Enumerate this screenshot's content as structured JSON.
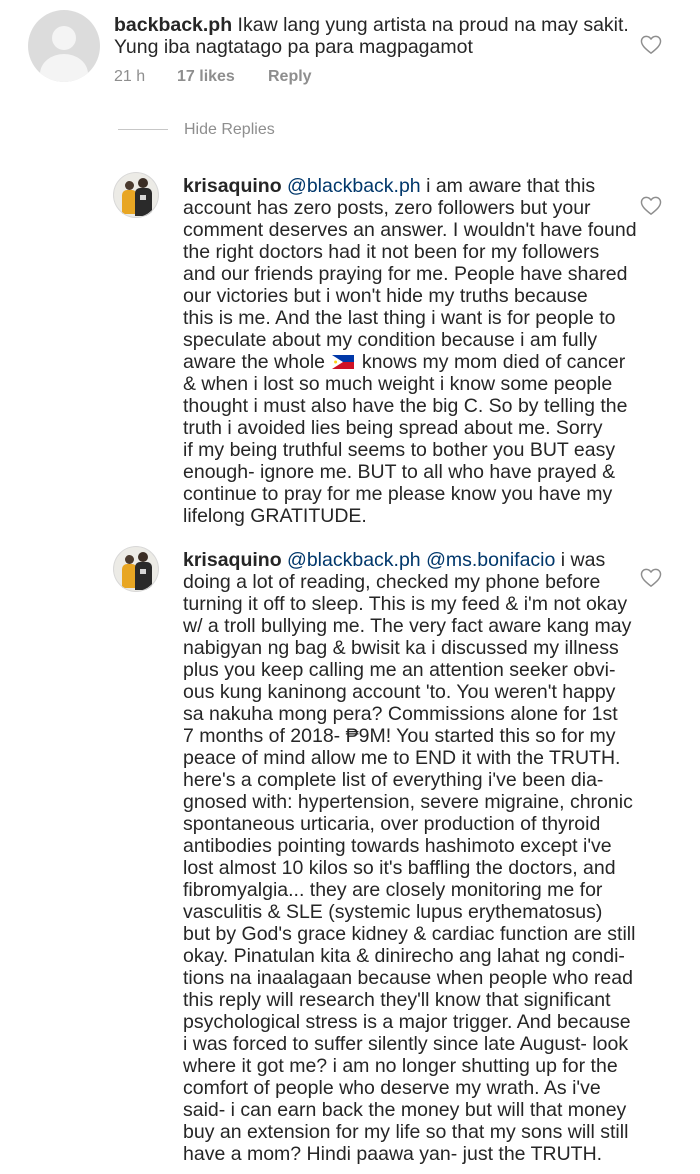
{
  "top_comment": {
    "username": "backback.ph",
    "lines": [
      " Ikaw lang yung artista na proud na may sakit.",
      "Yung iba nagtatago pa para magpagamot"
    ],
    "time": "21 h",
    "likes": "17 likes",
    "reply_label": "Reply"
  },
  "hide_replies_label": "Hide Replies",
  "reply1": {
    "username": "krisaquino",
    "mention": "@blackback.ph",
    "first_line_rest": " i am aware that this",
    "lines": [
      "account has zero posts, zero followers but your",
      "comment deserves an answer. I wouldn't have found",
      "the right doctors had it not been for my followers",
      "and our friends praying for me. People have shared",
      "our victories but i won't hide my truths because",
      "this is me. And the last thing i want is for people to",
      "speculate about my condition because i am fully"
    ],
    "flag_line_before": "aware the whole ",
    "flag_line_after": " knows my mom died of cancer",
    "lines_after": [
      "& when i lost so much weight i know some people",
      "thought i must also have the big C. So by telling the",
      "truth i avoided lies being spread about me. Sorry",
      "if my being truthful seems to bother you BUT easy",
      "enough- ignore me. BUT to all who have prayed &",
      "continue to pray for me please know you have my",
      "lifelong GRATITUDE."
    ]
  },
  "reply2": {
    "username": "krisaquino",
    "mention1": "@blackback.ph",
    "mention2": "@ms.bonifacio",
    "first_line_rest": " i was",
    "lines": [
      "doing a lot of reading, checked my phone before",
      "turning it off to sleep. This is my feed & i'm not okay",
      "w/ a troll bullying me. The very fact aware kang may",
      "nabigyan ng bag & bwisit ka i discussed my illness",
      "plus you keep calling me an attention seeker obvi-",
      "ous kung kaninong account 'to. You weren't happy",
      "sa nakuha mong pera? Commissions alone for 1st",
      "7 months of 2018- ₱9M! You started this so for my",
      "peace of mind allow me to END it with the TRUTH.",
      "here's a complete list of everything i've been dia-",
      "gnosed with: hypertension, severe migraine, chronic",
      "spontaneous urticaria, over production of thyroid",
      "antibodies pointing towards hashimoto except i've",
      "lost almost 10 kilos so it's baffling the doctors, and",
      "fibromyalgia... they are closely monitoring me for",
      "vasculitis & SLE (systemic lupus erythematosus)",
      "but by God's grace kidney & cardiac function are still",
      "okay. Pinatulan kita & dinirecho ang lahat ng condi-",
      "tions na inaalagaan because when people who read",
      "this reply will research they'll know that significant",
      "psychological stress is a major trigger. And because",
      "i was forced to suffer silently since late August- look",
      "where it got me? i am no longer shutting up for the",
      "comfort of people who deserve my wrath. As i've",
      "said- i can earn back the money but will that money",
      "buy an extension for my life so that my sons will still",
      "have a mom? Hindi paawa yan- just the TRUTH."
    ]
  },
  "icons": {
    "heart": "heart-outline-icon",
    "flag": "philippines-flag-icon",
    "avatar_default": "default-avatar-icon"
  },
  "colors": {
    "text": "#262626",
    "muted": "#8e8e8e",
    "mention": "#00376b"
  }
}
